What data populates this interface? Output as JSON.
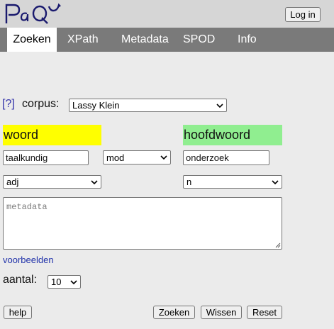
{
  "header": {
    "logo_text": "PaQU",
    "login_label": "Log in"
  },
  "nav": {
    "tabs": [
      {
        "label": "Zoeken",
        "active": true
      },
      {
        "label": "XPath",
        "active": false
      },
      {
        "label": "Metadata",
        "active": false
      },
      {
        "label": "SPOD",
        "active": false
      },
      {
        "label": "Info",
        "active": false
      }
    ]
  },
  "form": {
    "help_link": "[?]",
    "corpus_label": "corpus:",
    "corpus_value": "Lassy Klein",
    "word_label": "woord",
    "head_label": "hoofdwoord",
    "word_value": "taalkundig",
    "relation_value": "mod",
    "head_value": "onderzoek",
    "word_pos_value": "adj",
    "head_pos_value": "n",
    "metadata_placeholder": "metadata",
    "examples_link": "voorbeelden",
    "count_label": "aantal:",
    "count_value": "10"
  },
  "buttons": {
    "help": "help",
    "search": "Zoeken",
    "clear": "Wissen",
    "reset": "Reset"
  },
  "colors": {
    "word_highlight": "#ffff00",
    "head_highlight": "#90ee90",
    "nav_bg": "#7a7a7a",
    "header_bg": "#d6d6d6",
    "page_bg": "#ebebeb",
    "link": "#2233aa",
    "logo": "#1a1a6e"
  }
}
